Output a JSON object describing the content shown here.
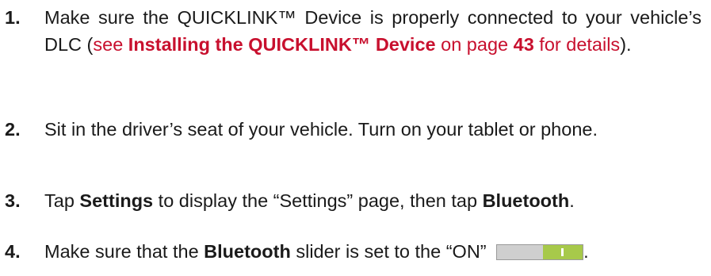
{
  "steps": [
    {
      "number": "1.",
      "text_a": "Make sure the QUICKLINK™ Device is properly connected to your vehicle’s DLC (",
      "link_see": "see ",
      "link_title": "Installing the QUICKLINK™ Device",
      "link_on_page": " on page ",
      "link_page": "43",
      "link_details": " for details",
      "text_b": ")."
    },
    {
      "number": "2.",
      "text": "Sit in the driver’s seat of your vehicle. Turn on your tablet or phone."
    },
    {
      "number": "3.",
      "text_a": "Tap ",
      "bold_a": "Settings",
      "text_b": " to display the “Settings” page, then tap ",
      "bold_b": "Bluetooth",
      "text_c": "."
    },
    {
      "number": "4.",
      "text_a": "Make sure that the ",
      "bold_a": "Bluetooth",
      "text_b": " slider is set to the “ON” ",
      "text_c": ".",
      "slider_state": "on"
    }
  ],
  "colors": {
    "text": "#1a1a1a",
    "link": "#c8102e",
    "slider_on": "#a7c94a",
    "slider_off": "#cfcfcf"
  }
}
